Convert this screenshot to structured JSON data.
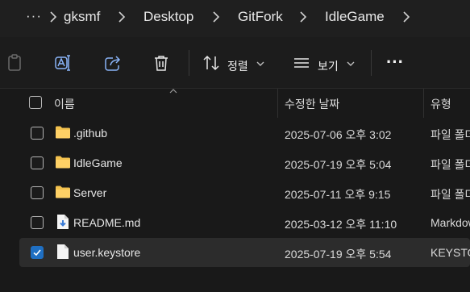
{
  "breadcrumb": {
    "more": "···",
    "items": [
      "gksmf",
      "Desktop",
      "GitFork",
      "IdleGame"
    ]
  },
  "toolbar": {
    "sort_label": "정렬",
    "view_label": "보기",
    "more": "···"
  },
  "columns": {
    "name": "이름",
    "modified": "수정한 날짜",
    "type": "유형"
  },
  "files": [
    {
      "name": ".github",
      "modified": "2025-07-06 오후 3:02",
      "type": "파일 폴더",
      "icon": "folder-icon",
      "checked": false
    },
    {
      "name": "IdleGame",
      "modified": "2025-07-19 오후 5:04",
      "type": "파일 폴더",
      "icon": "folder-icon",
      "checked": false
    },
    {
      "name": "Server",
      "modified": "2025-07-11 오후 9:15",
      "type": "파일 폴더",
      "icon": "folder-icon",
      "checked": false
    },
    {
      "name": "README.md",
      "modified": "2025-03-12 오후 11:10",
      "type": "Markdown",
      "icon": "markdown-file-icon",
      "checked": false
    },
    {
      "name": "user.keystore",
      "modified": "2025-07-19 오후 5:54",
      "type": "KEYSTORE",
      "icon": "file-icon",
      "checked": true
    }
  ],
  "colors": {
    "accent": "#1f6fc2",
    "folder": "#f2c14e",
    "background": "#191919"
  }
}
